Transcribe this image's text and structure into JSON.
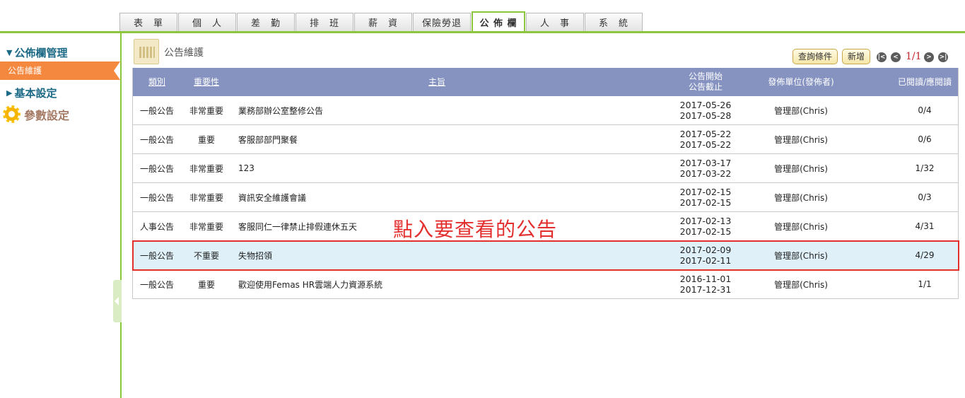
{
  "tabs": [
    {
      "label": "表　單",
      "active": false
    },
    {
      "label": "個　人",
      "active": false
    },
    {
      "label": "差　勤",
      "active": false
    },
    {
      "label": "排　班",
      "active": false
    },
    {
      "label": "薪　資",
      "active": false
    },
    {
      "label": "保險勞退",
      "active": false
    },
    {
      "label": "公 佈 欄",
      "active": true
    },
    {
      "label": "人　事",
      "active": false
    },
    {
      "label": "系　統",
      "active": false
    }
  ],
  "sidebar": {
    "group1": "公佈欄管理",
    "selected_item": "公告維護",
    "group2": "基本設定",
    "param": "參數設定"
  },
  "page": {
    "title": "公告維護",
    "query_button": "查詢條件",
    "add_button": "新增",
    "pager": "1/1"
  },
  "table": {
    "headers": {
      "type": "類別",
      "importance": "重要性",
      "subject": "主旨",
      "date_start": "公告開始",
      "date_end": "公告截止",
      "unit": "發佈單位(發佈者)",
      "read": "已閱讀/應閱讀"
    },
    "rows": [
      {
        "type": "一般公告",
        "importance": "非常重要",
        "subject": "業務部辦公室整修公告",
        "start": "2017-05-26",
        "end": "2017-05-28",
        "unit": "管理部(Chris)",
        "read": "0/4"
      },
      {
        "type": "一般公告",
        "importance": "重要",
        "subject": "客服部部門聚餐",
        "start": "2017-05-22",
        "end": "2017-05-22",
        "unit": "管理部(Chris)",
        "read": "0/6"
      },
      {
        "type": "一般公告",
        "importance": "非常重要",
        "subject": "123",
        "start": "2017-03-17",
        "end": "2017-03-22",
        "unit": "管理部(Chris)",
        "read": "1/32"
      },
      {
        "type": "一般公告",
        "importance": "非常重要",
        "subject": "資訊安全維護會議",
        "start": "2017-02-15",
        "end": "2017-02-15",
        "unit": "管理部(Chris)",
        "read": "0/3"
      },
      {
        "type": "人事公告",
        "importance": "非常重要",
        "subject": "客服同仁一律禁止排假連休五天",
        "start": "2017-02-13",
        "end": "2017-02-15",
        "unit": "管理部(Chris)",
        "read": "4/31"
      },
      {
        "type": "一般公告",
        "importance": "不重要",
        "subject": "失物招領",
        "start": "2017-02-09",
        "end": "2017-02-11",
        "unit": "管理部(Chris)",
        "read": "4/29"
      },
      {
        "type": "一般公告",
        "importance": "重要",
        "subject": "歡迎使用Femas HR雲端人力資源系統",
        "start": "2016-11-01",
        "end": "2017-12-31",
        "unit": "管理部(Chris)",
        "read": "1/1"
      }
    ]
  },
  "annotation": "點入要查看的公告",
  "colors": {
    "accent_green": "#8cc63f",
    "header_blue": "#8693c0",
    "selected_orange": "#f5883f",
    "highlight_red": "#e3302f"
  }
}
